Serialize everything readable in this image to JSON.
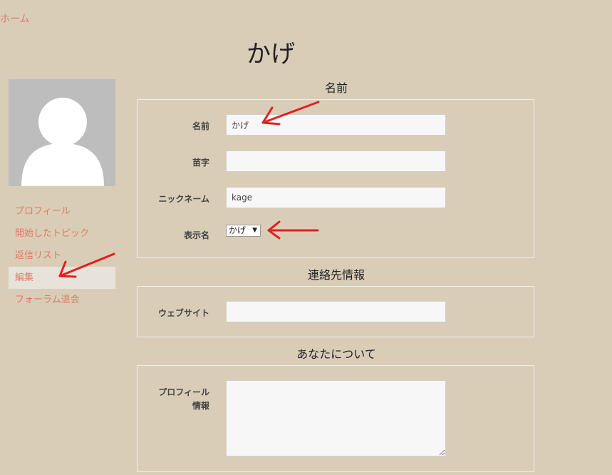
{
  "colors": {
    "background": "#d9cdb8",
    "link": "#e07a5f",
    "annotation": "#e02020"
  },
  "breadcrumb": {
    "home": "ホーム"
  },
  "page": {
    "title": "かげ"
  },
  "sidebar": {
    "items": [
      {
        "label": "プロフィール"
      },
      {
        "label": "開始したトピック"
      },
      {
        "label": "返信リスト"
      },
      {
        "label": "編集",
        "active": true
      },
      {
        "label": "フォーラム退会"
      }
    ]
  },
  "sections": {
    "name": {
      "title": "名前",
      "first_name": {
        "label": "名前",
        "value": "かげ"
      },
      "last_name": {
        "label": "苗字",
        "value": ""
      },
      "nickname": {
        "label": "ニックネーム",
        "value": "kage"
      },
      "display_name": {
        "label": "表示名",
        "selected": "かげ"
      }
    },
    "contact": {
      "title": "連絡先情報",
      "website": {
        "label": "ウェブサイト",
        "value": ""
      }
    },
    "about": {
      "title": "あなたについて",
      "bio": {
        "label_line1": "プロフィール",
        "label_line2": "情報",
        "value": ""
      }
    }
  }
}
